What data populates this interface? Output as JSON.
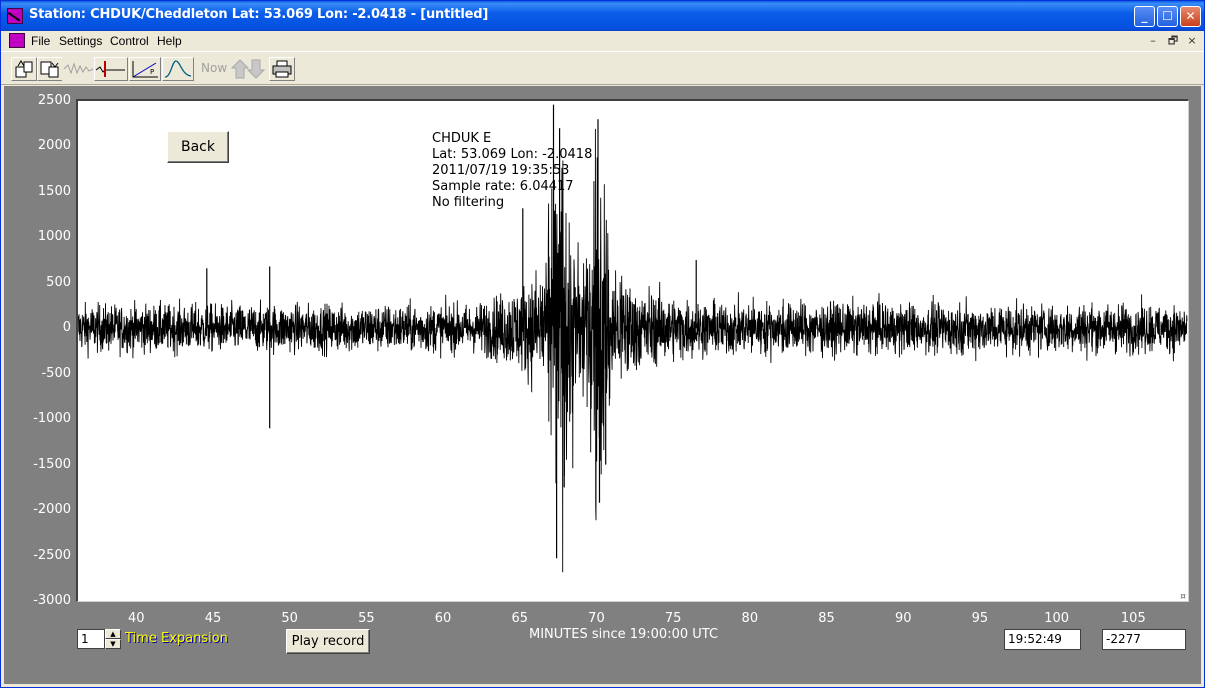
{
  "window": {
    "title": "Station: CHDUK/Cheddleton Lat: 53.069 Lon: -2.0418 - [untitled]",
    "controls": [
      "minimize",
      "maximize",
      "close"
    ]
  },
  "menu": {
    "items": [
      "File",
      "Settings",
      "Control",
      "Help"
    ],
    "mdi_controls": [
      "–",
      "🗗",
      "×"
    ]
  },
  "toolbar": {
    "tools": [
      {
        "icon": "open-file-icon",
        "enabled": true
      },
      {
        "icon": "save-file-icon",
        "enabled": true
      },
      {
        "icon": "waveform-icon",
        "enabled": false
      },
      {
        "icon": "pick-marker-icon",
        "enabled": true
      },
      {
        "icon": "line-p-icon",
        "enabled": true
      },
      {
        "icon": "spectrum-icon",
        "enabled": true
      },
      {
        "icon": "now-icon",
        "label": "Now",
        "enabled": false
      },
      {
        "icon": "up-down-arrows-icon",
        "enabled": false
      },
      {
        "icon": "printer-icon",
        "enabled": true
      }
    ]
  },
  "plot": {
    "back_label": "Back",
    "info": [
      "CHDUK  E",
      "Lat: 53.069 Lon: -2.0418",
      "2011/07/19 19:35:53",
      "Sample rate: 6.04417",
      "No filtering"
    ],
    "corner_mark": "¤"
  },
  "chart_data": {
    "type": "line",
    "title": "",
    "xlabel": "MINUTES since 19:00:00 UTC",
    "ylabel": "",
    "xlim": [
      36.2,
      108.5
    ],
    "ylim": [
      -3000,
      2500
    ],
    "x_ticks": [
      40,
      45,
      50,
      55,
      60,
      65,
      70,
      75,
      80,
      85,
      90,
      95,
      100,
      105
    ],
    "y_ticks": [
      2500,
      2000,
      1500,
      1000,
      500,
      0,
      -500,
      -1000,
      -1500,
      -2000,
      -2500,
      -3000
    ],
    "grid": false,
    "series": [
      {
        "color": "#000000",
        "noise_amplitude": 230,
        "envelope": [
          [
            36.2,
            1
          ],
          [
            62,
            1
          ],
          [
            64,
            1.5
          ],
          [
            65.5,
            2.0
          ],
          [
            66.8,
            3.2
          ],
          [
            67.2,
            9.5
          ],
          [
            67.8,
            9.0
          ],
          [
            68.5,
            6.0
          ],
          [
            69.0,
            3.0
          ],
          [
            69.5,
            5.0
          ],
          [
            70.0,
            9.0
          ],
          [
            70.5,
            6.5
          ],
          [
            71.2,
            3.0
          ],
          [
            72.5,
            1.8
          ],
          [
            75,
            1.3
          ],
          [
            77,
            1.1
          ],
          [
            108.5,
            1
          ]
        ],
        "peaks": [
          {
            "x": 44.6,
            "y": 660
          },
          {
            "x": 48.7,
            "y": -1100
          },
          {
            "x": 48.7,
            "y": 680
          },
          {
            "x": 65.2,
            "y": 1320
          },
          {
            "x": 67.2,
            "y": 2460
          },
          {
            "x": 67.4,
            "y": -2530
          },
          {
            "x": 67.6,
            "y": 2200
          },
          {
            "x": 67.9,
            "y": -1750
          },
          {
            "x": 70.1,
            "y": 2300
          },
          {
            "x": 70.2,
            "y": -1920
          },
          {
            "x": 70.6,
            "y": -1500
          },
          {
            "x": 76.5,
            "y": 750
          }
        ]
      }
    ]
  },
  "controls": {
    "expansion_value": "1",
    "expansion_label": "Time Expansion",
    "play_label": "Play record",
    "time_readout": "19:52:49",
    "value_readout": "-2277"
  }
}
